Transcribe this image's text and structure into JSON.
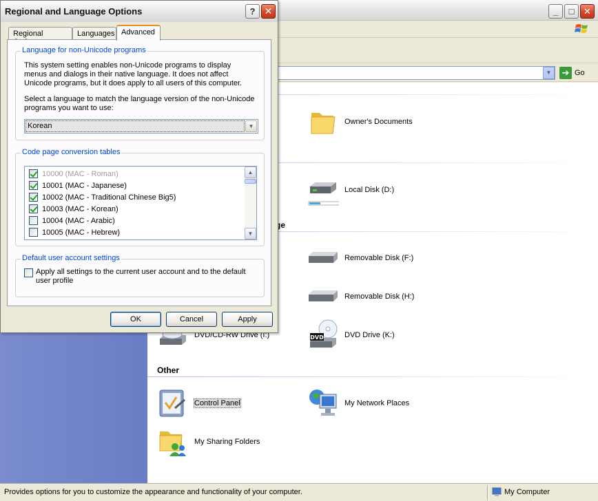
{
  "explorer": {
    "address": {
      "go_label": "Go"
    },
    "groups": [
      {
        "header": "",
        "items": [
          {
            "label": "Owner's Documents",
            "icon": "folder-icon"
          }
        ]
      },
      {
        "header": "",
        "items": [
          {
            "label": "Local Disk (D:)",
            "icon": "hard-disk-icon"
          }
        ]
      },
      {
        "header": "ge",
        "items": [
          {
            "label": "Removable Disk (F:)",
            "icon": "removable-disk-icon"
          },
          {
            "label": "Removable Disk (H:)",
            "icon": "removable-disk-icon"
          },
          {
            "label": "DVD/CD-RW Drive (I:)",
            "icon": "cd-drive-icon"
          },
          {
            "label": "DVD Drive (K:)",
            "icon": "dvd-drive-icon"
          }
        ]
      },
      {
        "header": "Other",
        "items": [
          {
            "label": "Control Panel",
            "icon": "control-panel-icon"
          },
          {
            "label": "My Network Places",
            "icon": "network-places-icon"
          },
          {
            "label": "My Sharing Folders",
            "icon": "sharing-folders-icon"
          }
        ]
      }
    ],
    "status": {
      "text": "Provides options for you to customize the appearance and functionality of your computer.",
      "location": "My Computer"
    }
  },
  "dialog": {
    "title": "Regional and Language Options",
    "tabs": [
      {
        "label": "Regional Options",
        "active": false
      },
      {
        "label": "Languages",
        "active": false
      },
      {
        "label": "Advanced",
        "active": true
      }
    ],
    "non_unicode": {
      "legend": "Language for non-Unicode programs",
      "description": "This system setting enables non-Unicode programs to display menus and dialogs in their native language. It does not affect Unicode programs, but it does apply to all users of this computer.",
      "select_label": "Select a language to match the language version of the non-Unicode programs you want to use:",
      "selected_language": "Korean"
    },
    "code_pages": {
      "legend": "Code page conversion tables",
      "items": [
        {
          "label": "10000 (MAC - Roman)",
          "checked": true,
          "disabled": true
        },
        {
          "label": "10001 (MAC - Japanese)",
          "checked": true,
          "disabled": false
        },
        {
          "label": "10002 (MAC - Traditional Chinese Big5)",
          "checked": true,
          "disabled": false
        },
        {
          "label": "10003 (MAC - Korean)",
          "checked": true,
          "disabled": false
        },
        {
          "label": "10004 (MAC - Arabic)",
          "checked": false,
          "disabled": false
        },
        {
          "label": "10005 (MAC - Hebrew)",
          "checked": false,
          "disabled": false
        }
      ]
    },
    "user_account": {
      "legend": "Default user account settings",
      "checkbox_label": "Apply all settings to the current user account and to the default user profile",
      "checked": false
    },
    "buttons": {
      "ok": "OK",
      "cancel": "Cancel",
      "apply": "Apply"
    }
  }
}
